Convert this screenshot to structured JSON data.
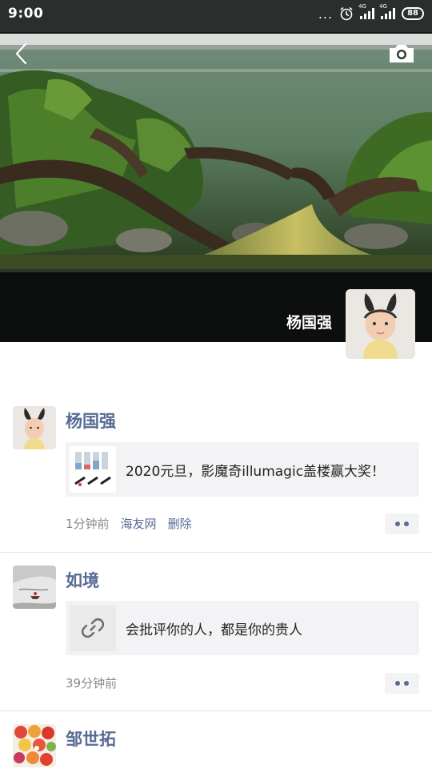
{
  "status_bar": {
    "time": "9:00",
    "dots": "...",
    "network_1": "4G",
    "network_2": "4G",
    "battery": "88",
    "icons": [
      "more-dots-icon",
      "alarm-icon",
      "signal-icon",
      "signal-icon",
      "battery-icon"
    ]
  },
  "cover": {
    "owner_name": "杨国强",
    "back_icon": "back-icon",
    "camera_icon": "camera-icon"
  },
  "posts": [
    {
      "author": "杨国强",
      "link_title": "2020元旦，影魔奇illumagic盖楼赢大奖！",
      "time": "1分钟前",
      "source": "海友网",
      "delete_label": "删除"
    },
    {
      "author": "如境",
      "link_title": "会批评你的人，都是你的贵人",
      "link_icon": "link-icon",
      "time": "39分钟前"
    },
    {
      "author": "邹世拓"
    }
  ],
  "colors": {
    "name_blue": "#576b95",
    "card_bg": "#f3f3f5",
    "meta_gray": "#888888"
  }
}
